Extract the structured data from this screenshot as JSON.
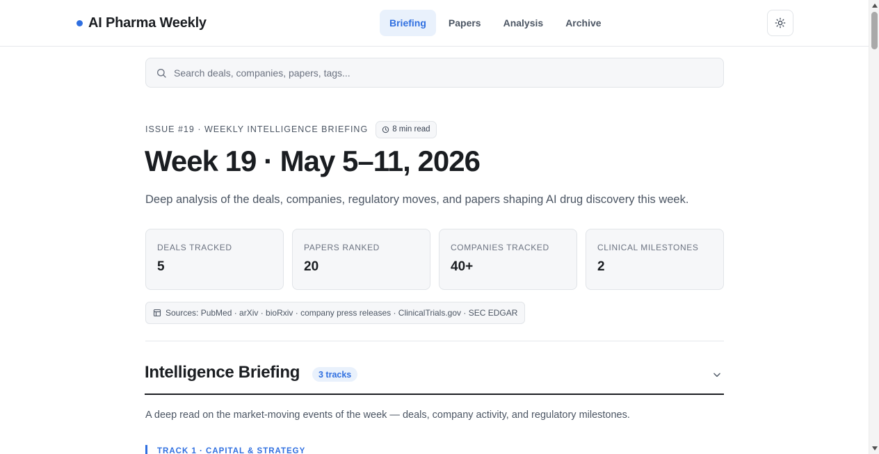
{
  "header": {
    "brand": "AI Pharma Weekly",
    "brand_color": "#2f6fe0",
    "nav": [
      {
        "label": "Briefing",
        "active": true
      },
      {
        "label": "Papers",
        "active": false
      },
      {
        "label": "Analysis",
        "active": false
      },
      {
        "label": "Archive",
        "active": false
      }
    ],
    "theme_toggle_icon": "sun-icon"
  },
  "search": {
    "placeholder": "Search deals, companies, papers, tags...",
    "value": ""
  },
  "issue": {
    "label": "ISSUE #19 · WEEKLY INTELLIGENCE BRIEFING",
    "read_time": "8 min read",
    "title": "Week 19 · May 5–11, 2026",
    "lede": "Deep analysis of the deals, companies, regulatory moves, and papers shaping AI drug discovery this week."
  },
  "stats": [
    {
      "label": "DEALS TRACKED",
      "value": "5"
    },
    {
      "label": "PAPERS RANKED",
      "value": "20"
    },
    {
      "label": "COMPANIES TRACKED",
      "value": "40+"
    },
    {
      "label": "CLINICAL MILESTONES",
      "value": "2"
    }
  ],
  "sources": "Sources: PubMed · arXiv · bioRxiv · company press releases · ClinicalTrials.gov · SEC EDGAR",
  "section": {
    "title": "Intelligence Briefing",
    "badge": "3 tracks",
    "description": "A deep read on the market-moving events of the week — deals, company activity, and regulatory milestones.",
    "first_track": "TRACK 1 · CAPITAL & STRATEGY"
  }
}
